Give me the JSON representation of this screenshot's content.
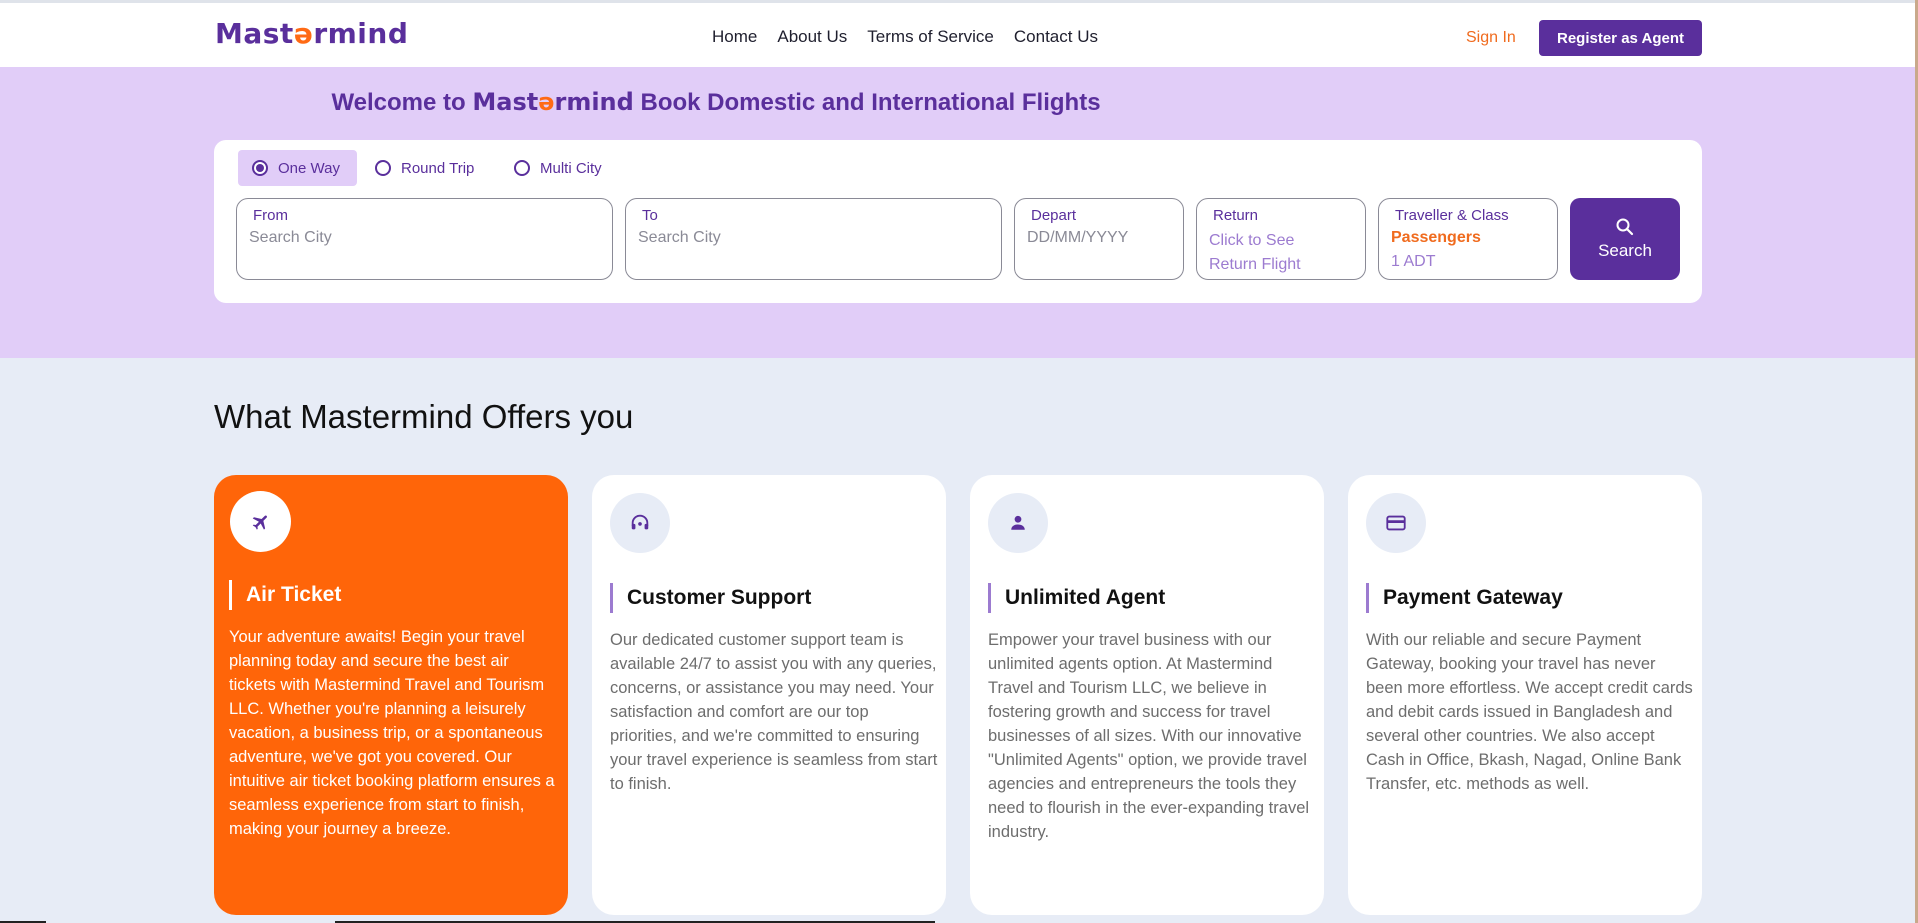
{
  "header": {
    "logo": {
      "pre": "Mast",
      "o": "ə",
      "post": "rmind"
    },
    "nav": [
      "Home",
      "About Us",
      "Terms of Service",
      "Contact Us"
    ],
    "sign_in": "Sign In",
    "register": "Register as Agent"
  },
  "hero": {
    "welcome_pre": "Welcome to",
    "brand_pre": "Mast",
    "brand_o": "ə",
    "brand_post": "rmind",
    "welcome_post": "Book Domestic and International Flights",
    "trip_types": [
      "One Way",
      "Round Trip",
      "Multi City"
    ],
    "selected_trip": "One Way",
    "from": {
      "label": "From",
      "placeholder": "Search City"
    },
    "to": {
      "label": "To",
      "placeholder": "Search City"
    },
    "depart": {
      "label": "Depart",
      "placeholder": "DD/MM/YYYY"
    },
    "return": {
      "label": "Return",
      "line1": "Click to See",
      "line2": "Return Flight"
    },
    "traveller": {
      "label": "Traveller & Class",
      "passengers": "Passengers",
      "count": "1 ADT"
    },
    "search": "Search"
  },
  "offers": {
    "title": "What Mastermind Offers you",
    "cards": [
      {
        "icon": "airplane-icon",
        "title": "Air Ticket",
        "body": "Your adventure awaits! Begin your travel planning today and secure the best air tickets with Mastermind Travel and Tourism LLC. Whether you're planning a leisurely vacation, a business trip, or a spontaneous adventure, we've got you covered. Our intuitive air ticket booking platform ensures a seamless experience from start to finish, making your journey a breeze."
      },
      {
        "icon": "headset-icon",
        "title": "Customer Support",
        "body": "Our dedicated customer support team is available 24/7 to assist you with any queries, concerns, or assistance you may need. Your satisfaction and comfort are our top priorities, and we're committed to ensuring your travel experience is seamless from start to finish."
      },
      {
        "icon": "person-icon",
        "title": "Unlimited Agent",
        "body": "Empower your travel business with our unlimited agents option. At Mastermind Travel and Tourism LLC, we believe in fostering growth and success for travel businesses of all sizes. With our innovative \"Unlimited Agents\" option, we provide travel agencies and entrepreneurs the tools they need to flourish in the ever-expanding travel industry."
      },
      {
        "icon": "credit-card-icon",
        "title": "Payment Gateway",
        "body": "With our reliable and secure Payment Gateway, booking your travel has never been more effortless. We accept credit cards and debit cards issued in Bangladesh and several other countries. We also accept Cash in Office, Bkash, Nagad, Online Bank Transfer, etc. methods as well."
      }
    ]
  },
  "colors": {
    "brand": "#5a2f9c",
    "accent": "#ff6509",
    "hero_bg": "#e1cdf8",
    "page_bg": "#e7ecf6"
  }
}
